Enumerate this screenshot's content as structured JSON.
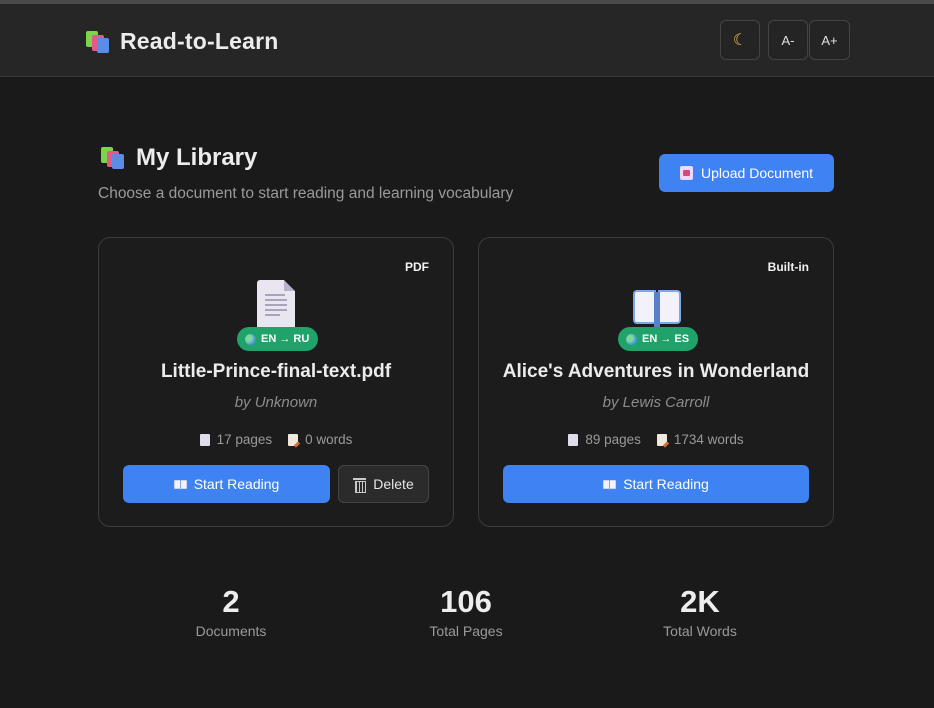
{
  "header": {
    "title": "Read-to-Learn",
    "theme_icon": "moon-icon",
    "font_decrease_label": "A-",
    "font_increase_label": "A+"
  },
  "library": {
    "title": "My Library",
    "subtitle": "Choose a document to start reading and learning vocabulary",
    "upload_label": "Upload Document"
  },
  "documents": [
    {
      "type": "PDF",
      "icon": "file-icon",
      "language": "EN → RU",
      "title": "Little-Prince-final-text.pdf",
      "author": "by Unknown",
      "pages": "17 pages",
      "words": "0 words",
      "start_label": "Start Reading",
      "delete_label": "Delete"
    },
    {
      "type": "Built-in",
      "icon": "book-icon",
      "language": "EN → ES",
      "title": "Alice's Adventures in Wonderland",
      "author": "by Lewis Carroll",
      "pages": "89 pages",
      "words": "1734 words",
      "start_label": "Start Reading"
    }
  ],
  "summary": [
    {
      "value": "2",
      "label": "Documents"
    },
    {
      "value": "106",
      "label": "Total Pages"
    },
    {
      "value": "2K",
      "label": "Total Words"
    }
  ],
  "colors": {
    "background": "#1a1a1a",
    "header": "#262626",
    "accent": "#3f82f2",
    "language_badge": "#1fa36a"
  }
}
